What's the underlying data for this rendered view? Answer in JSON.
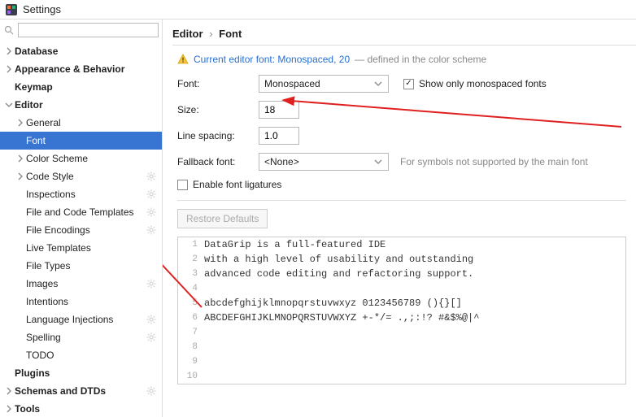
{
  "window": {
    "title": "Settings"
  },
  "sidebar": {
    "search_placeholder": "",
    "items": [
      {
        "label": "Database",
        "bold": true,
        "indent": 0,
        "arrow": "right"
      },
      {
        "label": "Appearance & Behavior",
        "bold": true,
        "indent": 0,
        "arrow": "right"
      },
      {
        "label": "Keymap",
        "bold": true,
        "indent": 0,
        "arrow": ""
      },
      {
        "label": "Editor",
        "bold": true,
        "indent": 0,
        "arrow": "down"
      },
      {
        "label": "General",
        "indent": 1,
        "arrow": "right"
      },
      {
        "label": "Font",
        "indent": 1,
        "arrow": "",
        "selected": true
      },
      {
        "label": "Color Scheme",
        "indent": 1,
        "arrow": "right"
      },
      {
        "label": "Code Style",
        "indent": 1,
        "arrow": "right",
        "gear": true
      },
      {
        "label": "Inspections",
        "indent": 1,
        "arrow": "",
        "gear": true
      },
      {
        "label": "File and Code Templates",
        "indent": 1,
        "arrow": "",
        "gear": true
      },
      {
        "label": "File Encodings",
        "indent": 1,
        "arrow": "",
        "gear": true
      },
      {
        "label": "Live Templates",
        "indent": 1,
        "arrow": ""
      },
      {
        "label": "File Types",
        "indent": 1,
        "arrow": ""
      },
      {
        "label": "Images",
        "indent": 1,
        "arrow": "",
        "gear": true
      },
      {
        "label": "Intentions",
        "indent": 1,
        "arrow": ""
      },
      {
        "label": "Language Injections",
        "indent": 1,
        "arrow": "",
        "gear": true
      },
      {
        "label": "Spelling",
        "indent": 1,
        "arrow": "",
        "gear": true
      },
      {
        "label": "TODO",
        "indent": 1,
        "arrow": ""
      },
      {
        "label": "Plugins",
        "bold": true,
        "indent": 0,
        "arrow": ""
      },
      {
        "label": "Schemas and DTDs",
        "bold": true,
        "indent": 0,
        "arrow": "right",
        "gear": true
      },
      {
        "label": "Tools",
        "bold": true,
        "indent": 0,
        "arrow": "right"
      }
    ]
  },
  "breadcrumb": {
    "root": "Editor",
    "sep": "›",
    "leaf": "Font"
  },
  "notice": {
    "link_text": "Current editor font: Monospaced, 20",
    "suffix": " — defined in the color scheme"
  },
  "form": {
    "font_label": "Font:",
    "font_value": "Monospaced",
    "show_mono_label": "Show only monospaced fonts",
    "show_mono_checked": true,
    "size_label": "Size:",
    "size_value": "18",
    "spacing_label": "Line spacing:",
    "spacing_value": "1.0",
    "fallback_label": "Fallback font:",
    "fallback_value": "<None>",
    "fallback_hint": "For symbols not supported by the main font",
    "ligatures_label": "Enable font ligatures",
    "ligatures_checked": false
  },
  "restore_btn": "Restore Defaults",
  "preview_lines": [
    "DataGrip is a full-featured IDE",
    "with a high level of usability and outstanding",
    "advanced code editing and refactoring support.",
    "",
    "abcdefghijklmnopqrstuvwxyz 0123456789 (){}[]",
    "ABCDEFGHIJKLMNOPQRSTUVWXYZ +-*/= .,;:!? #&$%@|^",
    "",
    "",
    "",
    ""
  ]
}
